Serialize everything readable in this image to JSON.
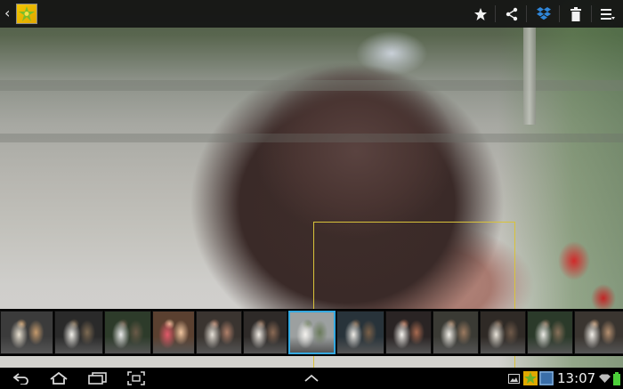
{
  "photo": {
    "description_icon": "photo-icon"
  },
  "top_bar": {
    "icons": {
      "back": "chevron-left-icon",
      "app": "gallery-app-icon",
      "favorite": "star-icon",
      "share": "share-icon",
      "dropbox": "dropbox-icon",
      "delete": "trash-icon",
      "menu": "overflow-menu-icon"
    },
    "back_glyph": "‹"
  },
  "filmstrip": {
    "selected_index": 6,
    "frames": [
      {
        "colors": [
          "#3b3b3b",
          "#e8e0d0",
          "#c59a6c"
        ]
      },
      {
        "colors": [
          "#2a2a2a",
          "#f2f0ea",
          "#7d6a52"
        ]
      },
      {
        "colors": [
          "#2d3b2a",
          "#eaeaea",
          "#6a5a48"
        ]
      },
      {
        "colors": [
          "#5a4030",
          "#e05a6a",
          "#f1c6a0"
        ]
      },
      {
        "colors": [
          "#3a3430",
          "#e6e1d8",
          "#b0806a"
        ]
      },
      {
        "colors": [
          "#2e2a28",
          "#f0ebe4",
          "#8a6a55"
        ]
      },
      {
        "colors": [
          "#9ca0a0",
          "#f4f2ee",
          "#6a7a5a"
        ]
      },
      {
        "colors": [
          "#28333a",
          "#efece6",
          "#7a6048"
        ]
      },
      {
        "colors": [
          "#2a2424",
          "#f5f3ee",
          "#a86a50"
        ]
      },
      {
        "colors": [
          "#3a3a34",
          "#f2efe8",
          "#9b7a60"
        ]
      },
      {
        "colors": [
          "#2f2a26",
          "#e9e4da",
          "#6f5a4a"
        ]
      },
      {
        "colors": [
          "#2b3a2a",
          "#ecebe6",
          "#87705a"
        ]
      },
      {
        "colors": [
          "#3a3530",
          "#f1eee8",
          "#b59070"
        ]
      }
    ]
  },
  "nav_bar": {
    "icons": {
      "back": "back-arrow-icon",
      "home": "home-icon",
      "recents": "recent-apps-icon",
      "screenshot": "screen-capture-icon",
      "expand": "chevron-up-icon",
      "gallery": "gallery-notification-icon",
      "thumbnail": "thumbnail-notification-icon",
      "wifi": "wifi-icon",
      "battery": "battery-icon"
    },
    "time": "13:07"
  },
  "colors": {
    "face_box": "#d8c23a",
    "selected_frame": "#34a9e0",
    "battery": "#4ccf3a",
    "dropbox": "#2f86d9"
  }
}
